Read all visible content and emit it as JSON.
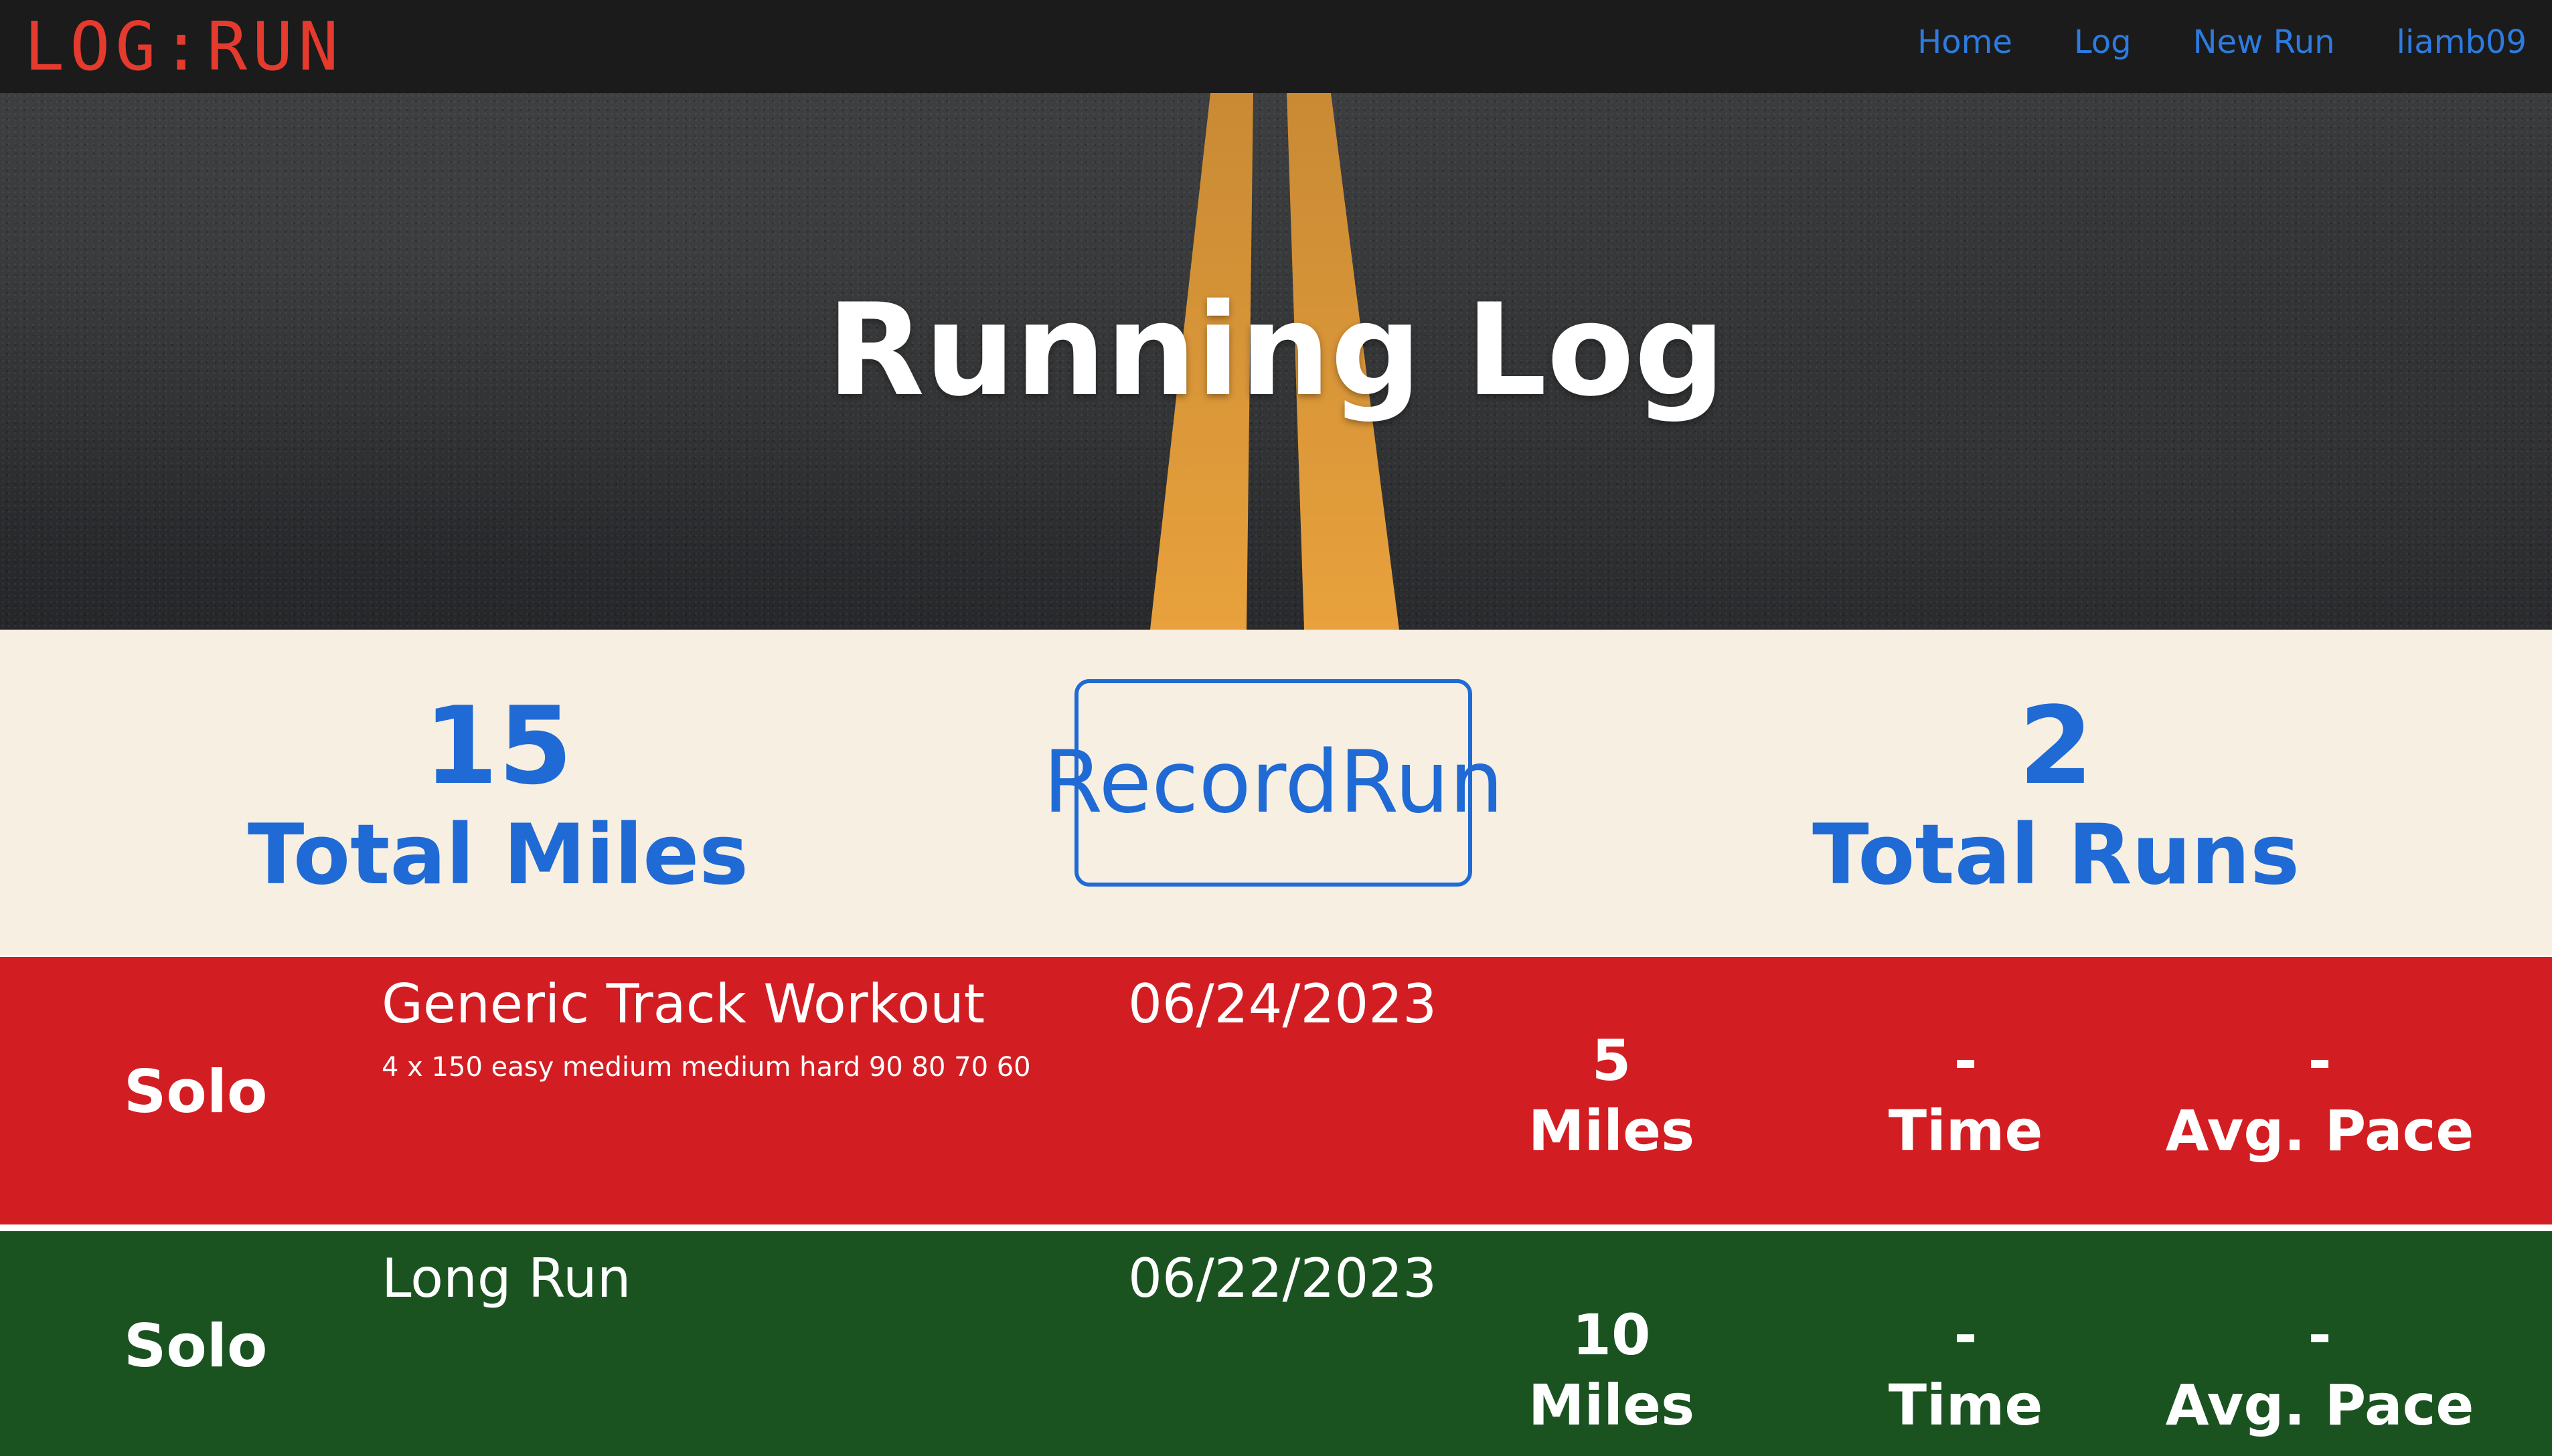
{
  "navbar": {
    "logo": "LOG:RUN",
    "links": [
      "Home",
      "Log",
      "New Run",
      "liamb09"
    ]
  },
  "hero": {
    "title": "Running Log"
  },
  "stats": {
    "total_miles_value": "15",
    "total_miles_label": "Total Miles",
    "record_button_label": "Record Run",
    "total_runs_value": "2",
    "total_runs_label": "Total Runs"
  },
  "colors": {
    "accent_blue": "#1f6ad4",
    "nav_link_blue": "#2d7be0",
    "logo_red": "#e53a2e",
    "row_red": "#d21e23",
    "row_green": "#1a5320",
    "stats_background": "#f7efe2",
    "navbar_background": "#1b1b1b",
    "road_line_yellow": "#e8a13c"
  },
  "runs": [
    {
      "type": "Solo",
      "title": "Generic Track Workout",
      "description": "4 x 150 easy medium medium hard 90 80 70 60",
      "date": "06/24/2023",
      "miles_value": "5",
      "miles_label": "Miles",
      "time_value": "-",
      "time_label": "Time",
      "pace_value": "-",
      "pace_label": "Avg. Pace"
    },
    {
      "type": "Solo",
      "title": "Long Run",
      "description": "",
      "date": "06/22/2023",
      "miles_value": "10",
      "miles_label": "Miles",
      "time_value": "-",
      "time_label": "Time",
      "pace_value": "-",
      "pace_label": "Avg. Pace"
    }
  ]
}
